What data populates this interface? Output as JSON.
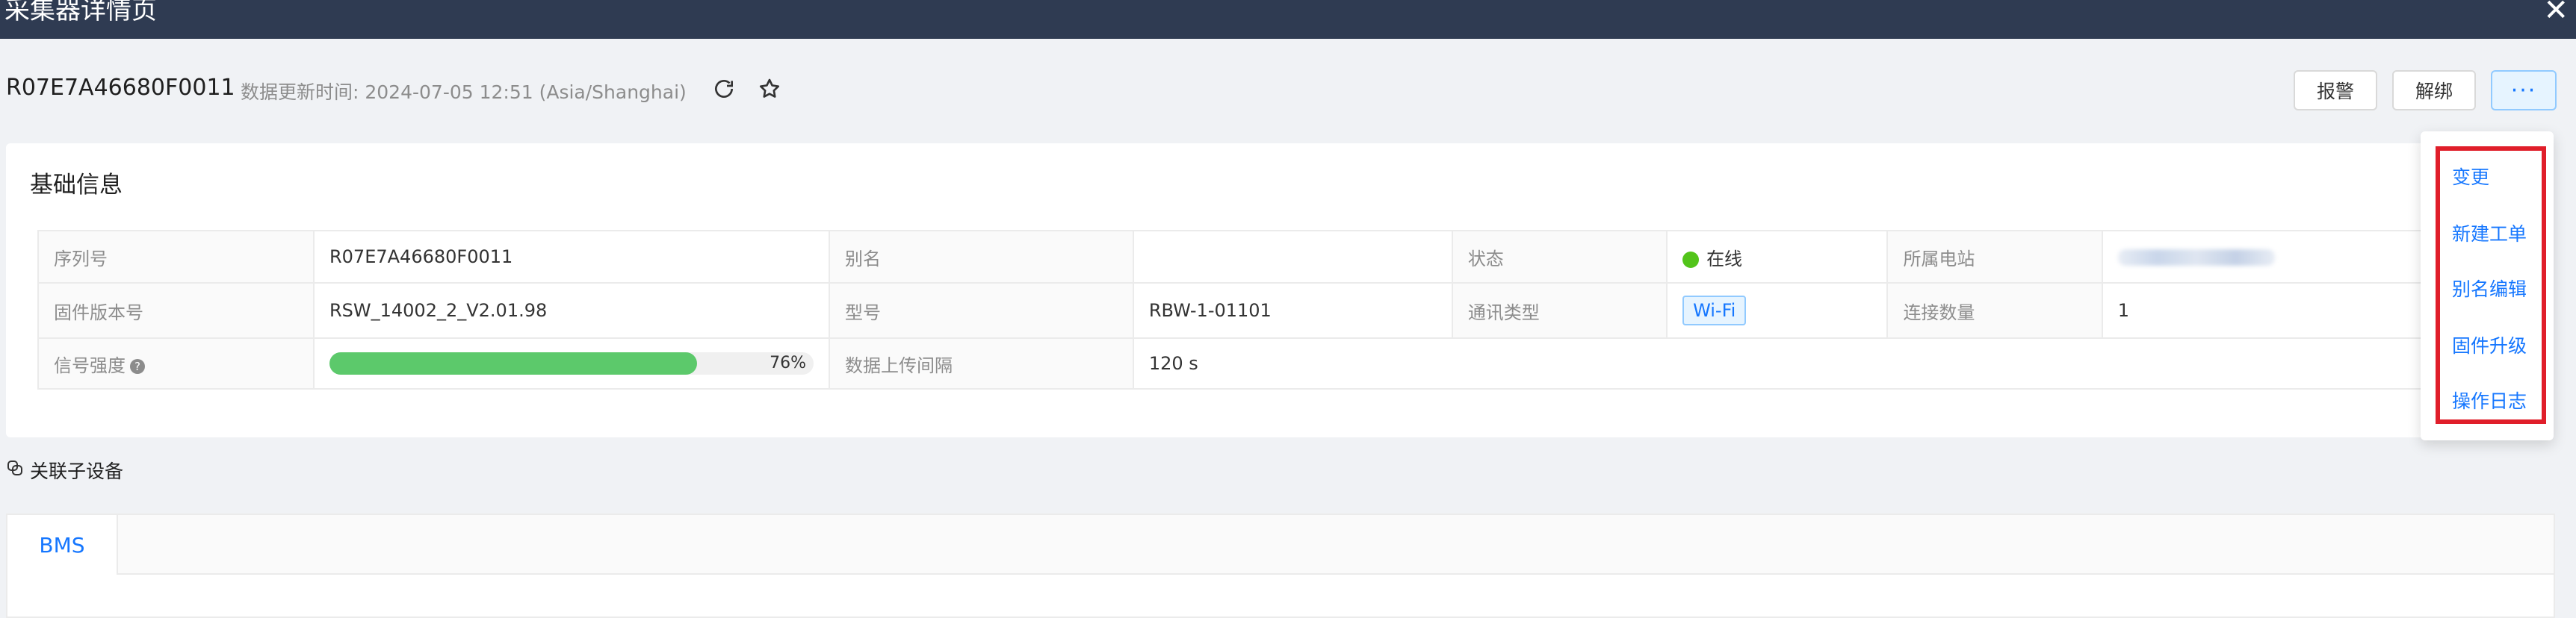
{
  "window": {
    "title": "采集器详情页"
  },
  "header": {
    "device_id": "R07E7A46680F0011",
    "update_time": "数据更新时间: 2024-07-05 12:51 (Asia/Shanghai)",
    "buttons": {
      "alarm": "报警",
      "unbind": "解绑",
      "more": "···"
    }
  },
  "basic_info": {
    "title": "基础信息",
    "rows": [
      [
        {
          "label": "序列号",
          "value": "R07E7A46680F0011"
        },
        {
          "label": "别名",
          "value": ""
        },
        {
          "label": "状态",
          "value": "在线"
        },
        {
          "label": "所属电站",
          "value": ""
        }
      ],
      [
        {
          "label": "固件版本号",
          "value": "RSW_14002_2_V2.01.98"
        },
        {
          "label": "型号",
          "value": "RBW-1-01101"
        },
        {
          "label": "通讯类型",
          "value": "Wi-Fi"
        },
        {
          "label": "连接数量",
          "value": "1"
        }
      ],
      [
        {
          "label": "信号强度",
          "value": "76%"
        },
        {
          "label": "数据上传间隔",
          "value": "120 s"
        }
      ]
    ],
    "signal_strength": 0.76,
    "status_color": "#52c41a"
  },
  "sub_devices": {
    "title": "关联子设备",
    "tabs": [
      "BMS"
    ]
  },
  "dropdown_menu": {
    "items": [
      "变更",
      "新建工单",
      "别名编辑",
      "固件升级",
      "操作日志"
    ],
    "highlight_color": "#e01e2a"
  },
  "colors": {
    "accent": "#1677ff",
    "topbar": "#2f3b52",
    "progress": "#5cc96b"
  }
}
